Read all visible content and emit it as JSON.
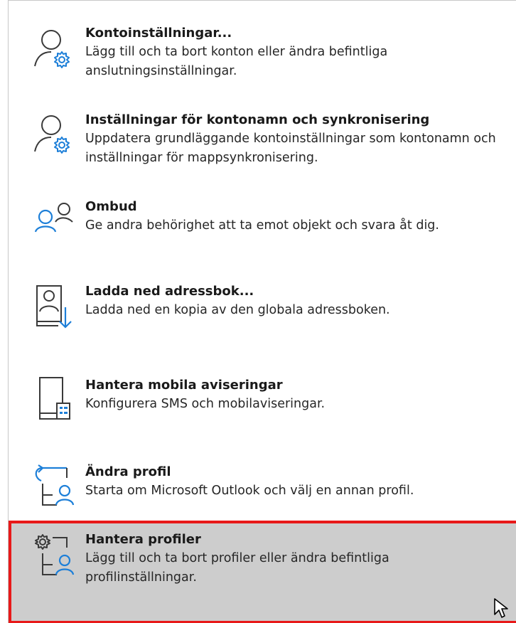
{
  "colors": {
    "accent": "#1d7fd8",
    "icon_stroke": "#3a3a3a",
    "selected_bg": "#cdcdcd",
    "selected_border": "#e81919"
  },
  "items": [
    {
      "title": "Kontoinställningar...",
      "desc": "Lägg till och ta bort konton eller ändra befintliga anslutningsinställningar.",
      "icon": "account-settings-icon"
    },
    {
      "title": "Inställningar för kontonamn och synkronisering",
      "desc": "Uppdatera grundläggande kontoinställningar som kontonamn och inställningar för mappsynkronisering.",
      "icon": "account-sync-settings-icon"
    },
    {
      "title": "Ombud",
      "desc": "Ge andra behörighet att ta emot objekt och svara åt dig.",
      "icon": "delegates-icon"
    },
    {
      "title": "Ladda ned adressbok...",
      "desc": "Ladda ned en kopia av den globala adressboken.",
      "icon": "download-address-book-icon"
    },
    {
      "title": "Hantera mobila aviseringar",
      "desc": "Konfigurera SMS och mobilaviseringar.",
      "icon": "mobile-alerts-icon"
    },
    {
      "title": "Ändra profil",
      "desc": "Starta om Microsoft Outlook och välj en annan profil.",
      "icon": "change-profile-icon"
    },
    {
      "title": "Hantera profiler",
      "desc": "Lägg till och ta bort profiler eller ändra befintliga profilinställningar.",
      "icon": "manage-profiles-icon",
      "selected": true
    }
  ]
}
